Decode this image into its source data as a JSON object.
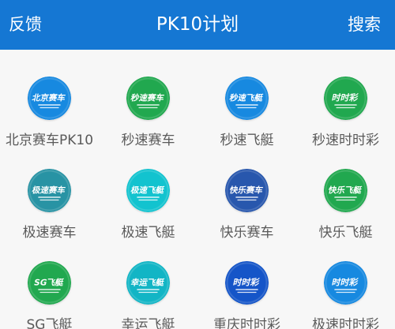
{
  "header": {
    "feedback_label": "反馈",
    "title": "PK10计划",
    "search_label": "搜索",
    "background_color": "#1577d3"
  },
  "games": [
    {
      "label": "北京赛车PK10",
      "logo_text": "北京赛车",
      "icon": "car-racing-icon",
      "color": "#1789e0"
    },
    {
      "label": "秒速赛车",
      "logo_text": "秒速赛车",
      "icon": "car-racing-icon",
      "color": "#21a84f"
    },
    {
      "label": "秒速飞艇",
      "logo_text": "秒速飞艇",
      "icon": "speedboat-icon",
      "color": "#1789e0"
    },
    {
      "label": "秒速时时彩",
      "logo_text": "时时彩",
      "icon": "lottery-icon",
      "color": "#21a84f"
    },
    {
      "label": "极速赛车",
      "logo_text": "极速赛车",
      "icon": "car-racing-icon",
      "color": "#2893a4"
    },
    {
      "label": "极速飞艇",
      "logo_text": "极速飞艇",
      "icon": "speedboat-icon",
      "color": "#12c3cf"
    },
    {
      "label": "快乐赛车",
      "logo_text": "快乐赛车",
      "icon": "car-racing-icon",
      "color": "#2857ad"
    },
    {
      "label": "快乐飞艇",
      "logo_text": "快乐飞艇",
      "icon": "speedboat-icon",
      "color": "#21a84f"
    },
    {
      "label": "SG飞艇",
      "logo_text": "SG飞艇",
      "icon": "speedboat-icon",
      "color": "#21a84f"
    },
    {
      "label": "幸运飞艇",
      "logo_text": "幸运飞艇",
      "icon": "speedboat-icon",
      "color": "#12b5c5"
    },
    {
      "label": "重庆时时彩",
      "logo_text": "时时彩",
      "icon": "lottery-icon",
      "color": "#1555c8"
    },
    {
      "label": "极速时时彩",
      "logo_text": "时时彩",
      "icon": "lottery-icon",
      "color": "#1789e0"
    }
  ]
}
